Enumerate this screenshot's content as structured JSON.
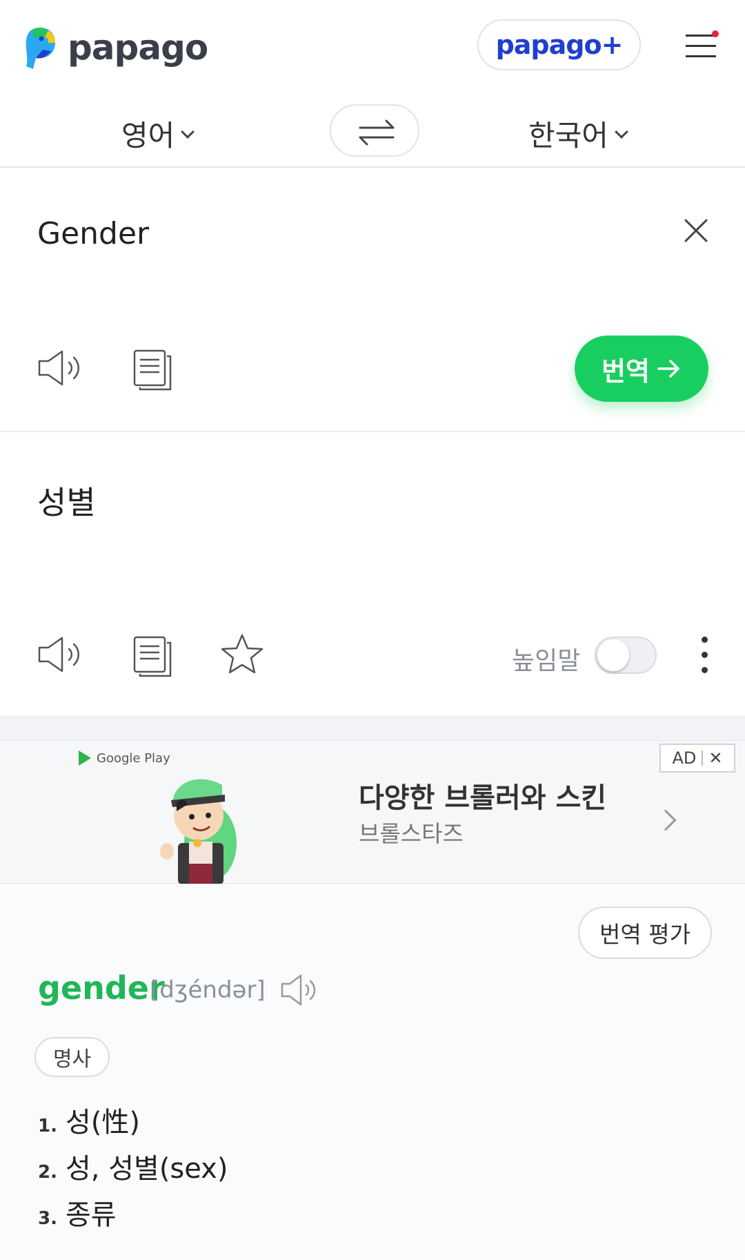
{
  "header": {
    "logo_text": "papago",
    "plus_label": "papago+",
    "menu_icon": "hamburger-menu-icon",
    "menu_badge_color": "#e8243a",
    "logo_colors": [
      "#2aa9f0",
      "#1e3fd0",
      "#25c45a",
      "#f6c90e"
    ]
  },
  "language_bar": {
    "source_language": "영어",
    "target_language": "한국어",
    "swap_icon": "swap-arrows-icon"
  },
  "source": {
    "text": "Gender",
    "clear_icon": "close-icon",
    "speaker_icon": "speaker-icon",
    "copy_icon": "copy-icon",
    "translate_label": "번역",
    "translate_icon": "arrow-right-icon",
    "accent_color": "#19ce60"
  },
  "result": {
    "text": "성별",
    "speaker_icon": "speaker-icon",
    "copy_icon": "copy-icon",
    "favorite_icon": "star-icon",
    "honorific_label": "높임말",
    "honorific_enabled": false,
    "more_icon": "more-vertical-icon"
  },
  "ad": {
    "store_badge": "Google Play",
    "title": "다양한 브롤러와 스킨",
    "subtitle": "브롤스타즈",
    "ad_label": "AD",
    "close_symbol": "✕"
  },
  "dictionary": {
    "rate_label": "번역 평가",
    "word": "gender",
    "phonetic": "[dʒéndər]",
    "part_of_speech": "명사",
    "meanings": [
      {
        "num": "1.",
        "text": "성(性)"
      },
      {
        "num": "2.",
        "text": "성, 성별(sex)"
      },
      {
        "num": "3.",
        "text": "종류"
      }
    ]
  }
}
